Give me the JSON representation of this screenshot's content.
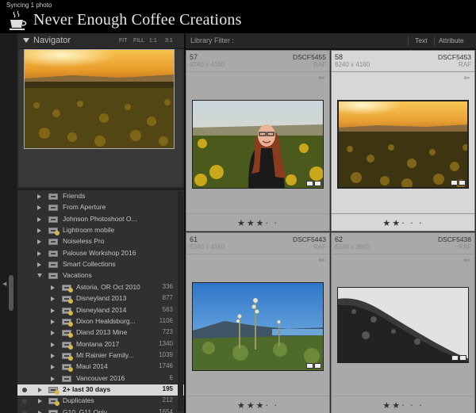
{
  "status": {
    "sync_text": "Syncing 1 photo"
  },
  "identity_plate": {
    "text": "Never Enough Coffee Creations"
  },
  "navigator": {
    "title": "Navigator",
    "zoom_options": [
      "FIT",
      "FILL",
      "1:1",
      "3:1"
    ]
  },
  "collections": [
    {
      "label": "Friends",
      "count": "",
      "indent": 1,
      "expanded": false,
      "smart": false
    },
    {
      "label": "From Aperture",
      "count": "",
      "indent": 1,
      "expanded": false,
      "smart": false
    },
    {
      "label": "Johnson Photoshoot O...",
      "count": "",
      "indent": 1,
      "expanded": false,
      "smart": false
    },
    {
      "label": "Lightroom mobile",
      "count": "",
      "indent": 1,
      "expanded": false,
      "smart": true
    },
    {
      "label": "Noiseless Pro",
      "count": "",
      "indent": 1,
      "expanded": false,
      "smart": false
    },
    {
      "label": "Palouse Workshop 2016",
      "count": "",
      "indent": 1,
      "expanded": false,
      "smart": false
    },
    {
      "label": "Smart Collections",
      "count": "",
      "indent": 1,
      "expanded": false,
      "smart": false
    },
    {
      "label": "Vacations",
      "count": "",
      "indent": 1,
      "expanded": true,
      "smart": false
    },
    {
      "label": "Astoria, OR Oct 2010",
      "count": "336",
      "indent": 2,
      "expanded": false,
      "smart": true
    },
    {
      "label": "Disneyland 2013",
      "count": "877",
      "indent": 2,
      "expanded": false,
      "smart": true
    },
    {
      "label": "Disneyland 2014",
      "count": "563",
      "indent": 2,
      "expanded": false,
      "smart": true
    },
    {
      "label": "Dixon Healdsburg...",
      "count": "1106",
      "indent": 2,
      "expanded": false,
      "smart": true
    },
    {
      "label": "Dland 2013 Mine",
      "count": "723",
      "indent": 2,
      "expanded": false,
      "smart": true
    },
    {
      "label": "Montana 2017",
      "count": "1340",
      "indent": 2,
      "expanded": false,
      "smart": true
    },
    {
      "label": "Mt Rainier Family...",
      "count": "1039",
      "indent": 2,
      "expanded": false,
      "smart": true
    },
    {
      "label": "Maui 2014",
      "count": "1746",
      "indent": 2,
      "expanded": false,
      "smart": true
    },
    {
      "label": "Vancouver 2016",
      "count": "6",
      "indent": 2,
      "expanded": false,
      "smart": false
    },
    {
      "label": "2+ last 30 days",
      "count": "195",
      "indent": 0,
      "expanded": false,
      "smart": true,
      "selected": true
    },
    {
      "label": "Duplicates",
      "count": "212",
      "indent": 0,
      "expanded": false,
      "smart": true
    },
    {
      "label": "G10_G11 Only",
      "count": "1654",
      "indent": 0,
      "expanded": false,
      "smart": true
    }
  ],
  "library_filter": {
    "label": "Library Filter :",
    "tabs": [
      "Text",
      "Attribute"
    ]
  },
  "grid": [
    {
      "index": "57",
      "dimensions": "6240 x 4160",
      "filename": "DSCF5455",
      "ext": "RAF",
      "rating": 3,
      "selected": false,
      "scene": "portrait"
    },
    {
      "index": "58",
      "dimensions": "6240 x 4160",
      "filename": "DSCF5453",
      "ext": "RAF",
      "rating": 2,
      "selected": true,
      "scene": "sunflowers"
    },
    {
      "index": "61",
      "dimensions": "6240 x 4160",
      "filename": "DSCF5443",
      "ext": "RAF",
      "rating": 3,
      "selected": false,
      "scene": "coast"
    },
    {
      "index": "62",
      "dimensions": "6240 x 3602",
      "filename": "DSCF5438",
      "ext": "RAF",
      "rating": 2,
      "selected": false,
      "scene": "bw-hill"
    }
  ],
  "colors": {
    "sunset": "#f0b43c",
    "selection": "#d9d9d9"
  }
}
